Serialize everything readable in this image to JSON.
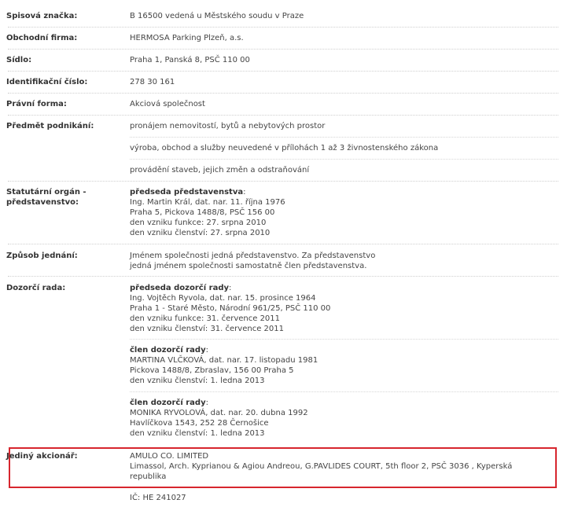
{
  "rows": {
    "spisova": {
      "label": "Spisová značka:",
      "value": "B 16500 vedená u Městského soudu v Praze"
    },
    "firma": {
      "label": "Obchodní firma:",
      "value": "HERMOSA Parking Plzeň, a.s."
    },
    "sidlo": {
      "label": "Sídlo:",
      "value": "Praha 1, Panská 8, PSČ 110 00"
    },
    "ico": {
      "label": "Identifikační číslo:",
      "value": "278 30 161"
    },
    "forma": {
      "label": "Právní forma:",
      "value": "Akciová společnost"
    },
    "predmet": {
      "label": "Předmět podnikání:",
      "items": [
        "pronájem nemovitostí, bytů a nebytových prostor",
        "výroba, obchod a služby neuvedené v přílohách 1 až 3 živnostenského zákona",
        "provádění staveb, jejich změn a odstraňování"
      ]
    },
    "statutarni": {
      "label_line1": "Statutární orgán -",
      "label_line2": "představenstvo:",
      "role": "předseda představenstva",
      "lines": [
        "Ing. Martin Král, dat. nar. 11. října 1976",
        "Praha 5, Pickova 1488/8, PSČ 156 00",
        "den vzniku funkce: 27. srpna 2010",
        "den vzniku členství: 27. srpna 2010"
      ]
    },
    "zpusob": {
      "label": "Způsob jednání:",
      "lines": [
        "Jménem společnosti jedná představenstvo. Za představenstvo",
        "jedná jménem společnosti samostatně člen představenstva."
      ]
    },
    "dozorci": {
      "label": "Dozorčí rada:",
      "members": [
        {
          "role": "předseda dozorčí rady",
          "lines": [
            "Ing. Vojtěch Ryvola, dat. nar. 15. prosince 1964",
            "Praha 1 - Staré Město, Národní 961/25, PSČ 110 00",
            "den vzniku funkce: 31. července 2011",
            "den vzniku členství: 31. července 2011"
          ]
        },
        {
          "role": "člen dozorčí rady",
          "lines": [
            "MARTINA VLČKOVÁ, dat. nar. 17. listopadu 1981",
            "Pickova 1488/8, Zbraslav, 156 00 Praha 5",
            "den vzniku členství: 1. ledna 2013"
          ]
        },
        {
          "role": "člen dozorčí rady",
          "lines": [
            "MONIKA RYVOLOVÁ, dat. nar. 20. dubna 1992",
            "Havlíčkova 1543, 252 28 Černošice",
            "den vzniku členství: 1. ledna 2013"
          ]
        }
      ]
    },
    "akcionar": {
      "label": "Jediný akcionář:",
      "lines": [
        "AMULO CO. LIMITED",
        "Limassol, Arch. Kyprianou & Agiou Andreou, G.PAVLIDES COURT, 5th floor 2, PSČ 3036 , Kyperská",
        "republika"
      ]
    },
    "ic": {
      "value": "IČ: HE 241027"
    }
  },
  "colors": {
    "highlight": "#d7262e"
  }
}
